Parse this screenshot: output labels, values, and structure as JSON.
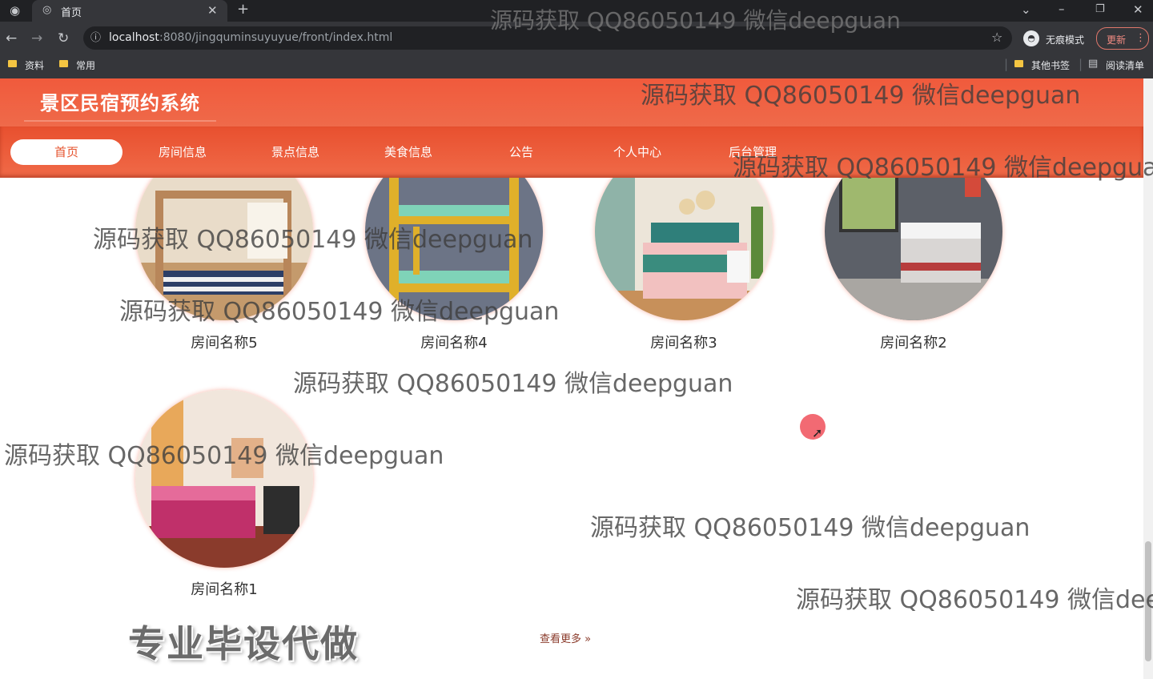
{
  "browser": {
    "tab_title": "首页",
    "url_host": "localhost",
    "url_rest": ":8080/jingquminsuyuyue/front/index.html",
    "incognito_label": "无痕模式",
    "update_label": "更新",
    "bookmarks": [
      "资料",
      "常用"
    ],
    "other_bookmarks": "其他书签",
    "reading_list": "阅读清单"
  },
  "site": {
    "title": "景区民宿预约系统",
    "nav": [
      "首页",
      "房间信息",
      "景点信息",
      "美食信息",
      "公告",
      "个人中心",
      "后台管理"
    ],
    "active_nav": "首页"
  },
  "rooms": [
    {
      "name": "房间名称5"
    },
    {
      "name": "房间名称4"
    },
    {
      "name": "房间名称3"
    },
    {
      "name": "房间名称2"
    },
    {
      "name": "房间名称1"
    }
  ],
  "more_link": "查看更多",
  "promo_text": "专业毕设代做",
  "watermark": "源码获取 QQ86050149 微信deepguan",
  "colors": {
    "brand": "#f05a3c",
    "nav": "#e8502f"
  }
}
